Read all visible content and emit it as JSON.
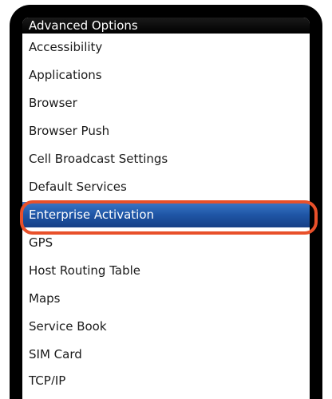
{
  "title_bar": {
    "title": "Advanced Options"
  },
  "menu": {
    "selected_index": 6,
    "items": [
      {
        "label": "Accessibility"
      },
      {
        "label": "Applications"
      },
      {
        "label": "Browser"
      },
      {
        "label": "Browser Push"
      },
      {
        "label": "Cell Broadcast Settings"
      },
      {
        "label": "Default Services"
      },
      {
        "label": "Enterprise Activation"
      },
      {
        "label": "GPS"
      },
      {
        "label": "Host Routing Table"
      },
      {
        "label": "Maps"
      },
      {
        "label": "Service Book"
      },
      {
        "label": "SIM Card"
      },
      {
        "label": "TCP/IP"
      }
    ]
  },
  "colors": {
    "selection": "#1f56a6",
    "highlight_ring": "#e8502a",
    "bezel": "#000000"
  }
}
